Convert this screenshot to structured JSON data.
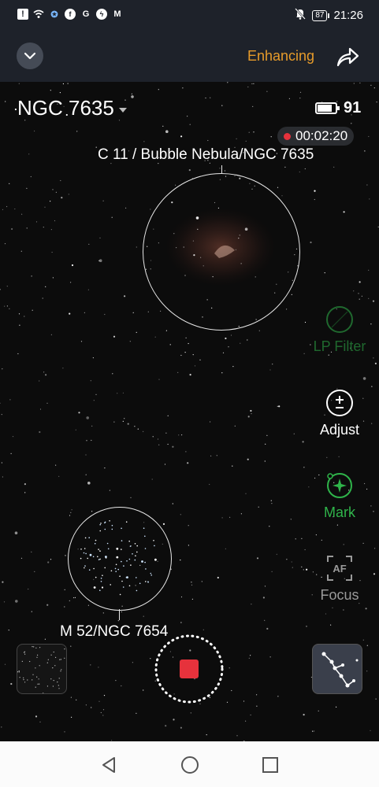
{
  "status_bar": {
    "time": "21:26",
    "battery": "87",
    "left_icons": [
      "alert-icon",
      "wifi-icon",
      "star-app-icon",
      "facebook-icon",
      "google-icon",
      "messenger-icon",
      "gmail-icon"
    ]
  },
  "app_bar": {
    "status_text": "Enhancing",
    "status_color": "#e69b2a"
  },
  "view": {
    "target_name": "NGC 7635",
    "device_battery": "91",
    "recording_time": "00:02:20",
    "objects": [
      {
        "label": "C 11 / Bubble Nebula/NGC 7635"
      },
      {
        "label": "M 52/NGC 7654"
      }
    ]
  },
  "tools": [
    {
      "label": "LP Filter",
      "icon": "lp-filter-icon",
      "state": "disabled"
    },
    {
      "label": "Adjust",
      "icon": "adjust-icon",
      "state": "normal"
    },
    {
      "label": "Mark",
      "icon": "mark-icon",
      "state": "active"
    },
    {
      "label": "Focus",
      "icon": "af-focus-icon",
      "state": "muted"
    }
  ],
  "colors": {
    "accent_green": "#2fb44a",
    "stop_red": "#e6323c",
    "orange": "#e69b2a"
  }
}
